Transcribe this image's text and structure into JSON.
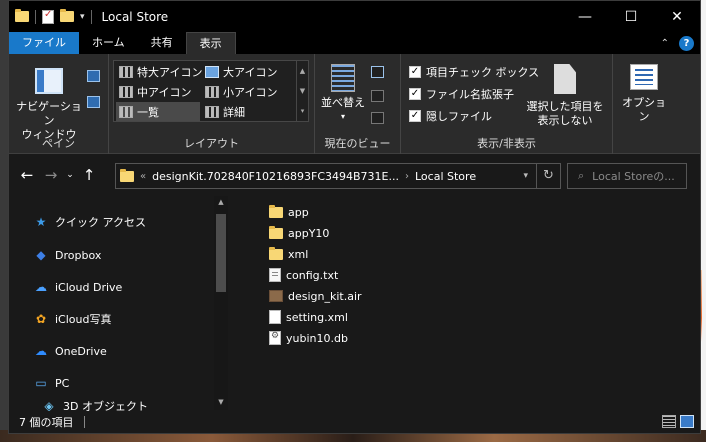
{
  "window": {
    "title": "Local Store",
    "controls": {
      "minimize": "—",
      "maximize": "☐",
      "close": "✕"
    }
  },
  "ribbon_tabs": [
    "ファイル",
    "ホーム",
    "共有",
    "表示"
  ],
  "ribbon": {
    "pane_group": {
      "nav_pane_label": "ナビゲーション\nウィンドウ",
      "group_label": "ペイン"
    },
    "layout_group": {
      "items": [
        "特大アイコン",
        "大アイコン",
        "中アイコン",
        "小アイコン",
        "一覧",
        "詳細"
      ],
      "selected": "一覧",
      "group_label": "レイアウト"
    },
    "current_view_group": {
      "sort_label": "並べ替え",
      "group_label": "現在のビュー"
    },
    "show_hide_group": {
      "checkboxes": [
        {
          "label": "項目チェック ボックス",
          "checked": true
        },
        {
          "label": "ファイル名拡張子",
          "checked": true
        },
        {
          "label": "隠しファイル",
          "checked": true
        }
      ],
      "hide_selected_label": "選択した項目を\n表示しない",
      "group_label": "表示/非表示"
    },
    "options_label": "オプション"
  },
  "address_bar": {
    "breadcrumb_prefix": "«",
    "path_parts": [
      "designKit.702840F10216893FC3494B731E...",
      "Local Store"
    ],
    "separator": "›"
  },
  "search": {
    "placeholder": "Local Storeの..."
  },
  "sidebar": {
    "items": [
      {
        "label": "クイック アクセス",
        "icon": "star-icon"
      },
      {
        "label": "Dropbox",
        "icon": "dropbox-icon"
      },
      {
        "label": "iCloud Drive",
        "icon": "icloud-icon"
      },
      {
        "label": "iCloud写真",
        "icon": "icloud-photos-icon"
      },
      {
        "label": "OneDrive",
        "icon": "onedrive-icon"
      },
      {
        "label": "PC",
        "icon": "pc-icon"
      },
      {
        "label": "3D オブジェクト",
        "icon": "3d-objects-icon"
      }
    ]
  },
  "files": [
    {
      "name": "app",
      "type": "folder"
    },
    {
      "name": "appY10",
      "type": "folder"
    },
    {
      "name": "xml",
      "type": "folder"
    },
    {
      "name": "config.txt",
      "type": "txt"
    },
    {
      "name": "design_kit.air",
      "type": "air"
    },
    {
      "name": "setting.xml",
      "type": "xml"
    },
    {
      "name": "yubin10.db",
      "type": "db"
    }
  ],
  "status": {
    "item_count": "7 個の項目"
  },
  "colors": {
    "file_tab": "#1979ca",
    "folder": "#f8d775",
    "window_bg": "#191919",
    "ribbon_bg": "#2b2b2b"
  }
}
